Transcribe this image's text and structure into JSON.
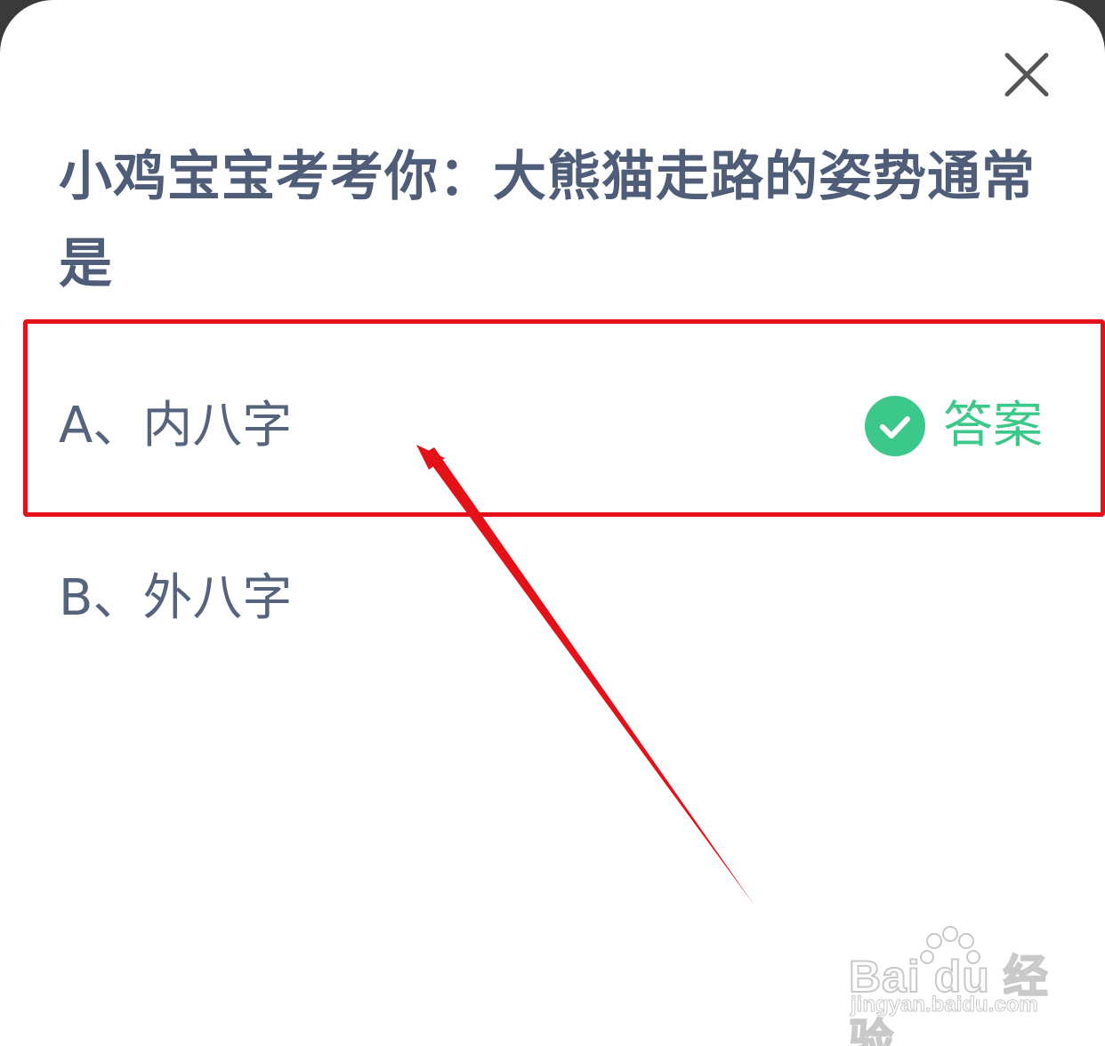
{
  "question": {
    "text": "小鸡宝宝考考你：大熊猫走路的姿势通常是"
  },
  "options": [
    {
      "label": "A、内八字",
      "is_answer": true
    },
    {
      "label": "B、外八字",
      "is_answer": false
    }
  ],
  "answer_tag": {
    "label": "答案",
    "icon": "check-circle-icon",
    "color": "#3cc88a"
  },
  "close": {
    "icon": "close-icon"
  },
  "annotation": {
    "box_color": "#e41218",
    "arrow_color": "#e41218"
  },
  "watermark": {
    "brand": "Bai du 经验",
    "url": "jingyan.baidu.com"
  }
}
